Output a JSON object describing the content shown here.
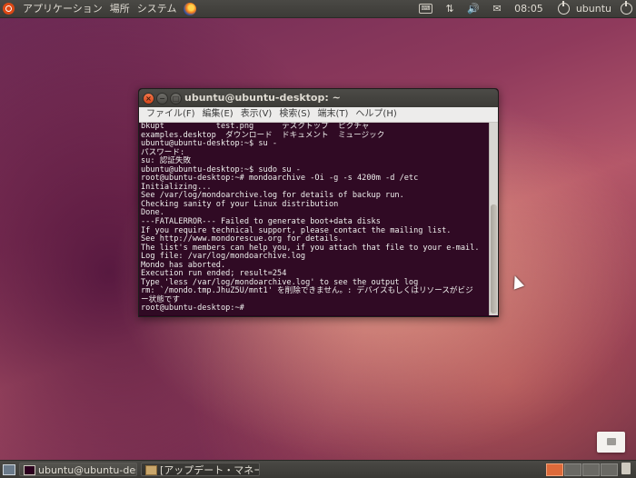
{
  "top_panel": {
    "applications": "アプリケーション",
    "places": "場所",
    "system": "システム",
    "clock": "08:05",
    "user": "ubuntu"
  },
  "terminal": {
    "title": "ubuntu@ubuntu-desktop: ~",
    "menu": [
      "ファイル(F)",
      "編集(E)",
      "表示(V)",
      "検索(S)",
      "端末(T)",
      "ヘルプ(H)"
    ],
    "lines": [
      "bkupt           test.png      デスクトップ  ピクチャ",
      "examples.desktop  ダウンロード  ドキュメント  ミュージック",
      "ubuntu@ubuntu-desktop:~$ su -",
      "パスワード:",
      "su: 認証失敗",
      "ubuntu@ubuntu-desktop:~$ sudo su -",
      "root@ubuntu-desktop:~# mondoarchive -Oi -g -s 4200m -d /etc",
      "Initializing...",
      "See /var/log/mondoarchive.log for details of backup run.",
      "Checking sanity of your Linux distribution",
      "Done.",
      "---FATALERROR--- Failed to generate boot+data disks",
      "If you require technical support, please contact the mailing list.",
      "See http://www.mondorescue.org for details.",
      "The list's members can help you, if you attach that file to your e-mail.",
      "Log file: /var/log/mondoarchive.log",
      "Mondo has aborted.",
      "Execution run ended; result=254",
      "Type 'less /var/log/mondoarchive.log' to see the output log",
      "rm: `/mondo.tmp.JhuZ5U/mnt1' を削除できません。: デバイスもしくはリソースがビジ",
      "ー状態です",
      "root@ubuntu-desktop:~#"
    ]
  },
  "taskbar": {
    "task1": "ubuntu@ubuntu-des...",
    "task2": "[アップデート・マネー..."
  },
  "icons": {
    "tray": [
      "keyboard-icon",
      "network-icon",
      "volume-icon",
      "mail-icon",
      "power-icon"
    ]
  }
}
